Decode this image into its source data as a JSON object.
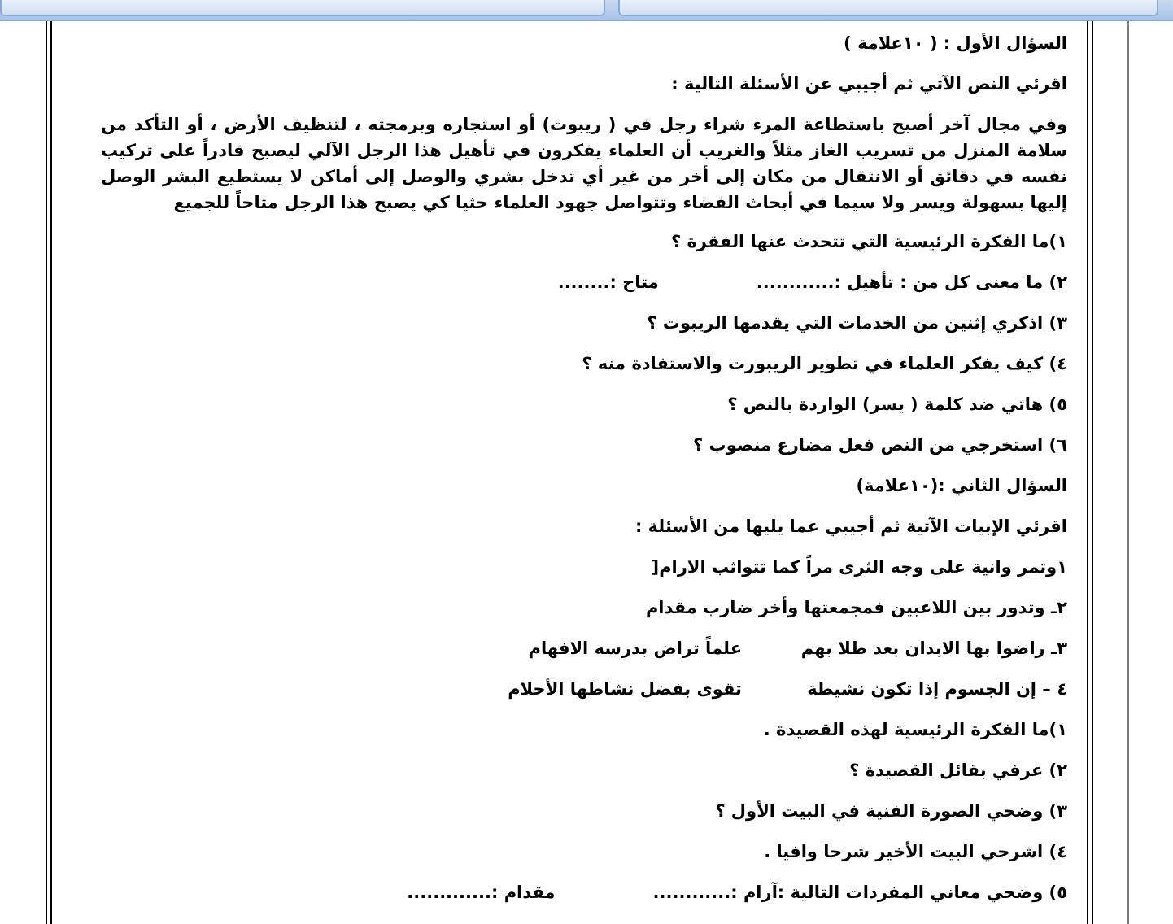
{
  "lines": [
    {
      "kind": "heading",
      "text": "السؤال الأول : ( ١٠علامة )"
    },
    {
      "kind": "instruction",
      "text": "اقرئي النص الآتي ثم أجيبي عن الأسئلة التالية :"
    },
    {
      "kind": "paragraph",
      "text": "وفي مجال آخر أصبح باستطاعة المرء شراء رجل في ( ريبوت) أو استجاره وبرمجته ، لتنظيف الأرض ، أو التأكد من سلامة المنزل من تسريب الغاز مثلاً والغريب أن العلماء يفكرون في تأهيل هذا الرجل الآلي ليصبح قادراً على تركيب نفسه في دقائق أو الانتقال من مكان إلى أخر من غير أي تدخل بشري والوصل إلى أماكن لا يستطيع البشر الوصل إليها بسهولة ويسر ولا سيما في أبحاث الفضاء وتتواصل جهود العلماء حثيا كي يصبح هذا الرجل متاحاً للجميع"
    },
    {
      "kind": "item",
      "text": "١)ما الفكرة الرئيسية التي تتحدث عنها الفقرة ؟"
    },
    {
      "kind": "pair",
      "parts": [
        "٢) ما معنى كل من : تأهيل :............",
        "متاح :........"
      ]
    },
    {
      "kind": "item",
      "text": "٣) اذكري إثنين من الخدمات التي يقدمها الريبوت ؟"
    },
    {
      "kind": "item",
      "text": "٤) كيف يفكر العلماء في تطوير الريبورت والاستفادة منه ؟"
    },
    {
      "kind": "item",
      "text": "٥) هاتي ضد كلمة ( يسر) الواردة بالنص ؟"
    },
    {
      "kind": "item",
      "text": "٦) استخرجي من النص فعل مضارع منصوب ؟"
    },
    {
      "kind": "heading",
      "text": "السؤال الثاني :(١٠علامة)"
    },
    {
      "kind": "instruction",
      "text": "اقرئي الإبيات الآتية ثم أجيبي عما يليها من الأسئلة :"
    },
    {
      "kind": "item",
      "text": "١وتمر وانية على وجه الثرى مراً كما تتواثب الارام["
    },
    {
      "kind": "item",
      "text": "٢ـ وتدور بين اللاعبين فمجمعتها وأخر ضارب مقدام"
    },
    {
      "kind": "verse",
      "parts": [
        "٣ـ راضوا بها الابدان بعد طلا بهم",
        "علماً تراض بدرسه الافهام"
      ]
    },
    {
      "kind": "verse",
      "parts": [
        "٤ – إن الجسوم إذا تكون نشيطة",
        "تقوى بفضل نشاطها الأحلام"
      ]
    },
    {
      "kind": "item",
      "text": "١)ما الفكرة الرئيسية لهذه القصيدة ."
    },
    {
      "kind": "item",
      "text": "٢) عرفي بقائل القصيدة ؟"
    },
    {
      "kind": "item",
      "text": "٣) وضحي الصورة الفنية في البيت الأول ؟"
    },
    {
      "kind": "item",
      "text": "٤) اشرحي البيت الأخير شرحا وافيا ."
    },
    {
      "kind": "pair",
      "parts": [
        "٥) وضحي معاني المفردات التالية :آرام :............",
        "مقدام :............."
      ]
    }
  ]
}
